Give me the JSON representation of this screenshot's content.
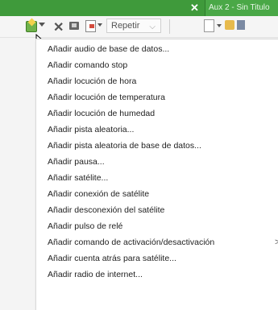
{
  "window": {
    "aux_tab_label": "Aux 2 - Sin Titulo",
    "close_glyph": "✕"
  },
  "toolbar": {
    "repeat_select_value": "Repetir",
    "icons": [
      "add-green-icon",
      "dropdown-arrow-icon",
      "delete-x-icon",
      "insert-box-icon",
      "doc-insert-icon",
      "dropdown-arrow-icon",
      "new-document-icon",
      "dropdown-arrow-icon",
      "open-folder-icon",
      "save-icon"
    ]
  },
  "menu": {
    "items": [
      {
        "label": "Añadir audio de base de datos..."
      },
      {
        "label": "Añadir comando stop"
      },
      {
        "label": "Añadir locución de hora"
      },
      {
        "label": "Añadir locución de temperatura"
      },
      {
        "label": "Añadir locución de humedad"
      },
      {
        "label": "Añadir pista aleatoria..."
      },
      {
        "label": "Añadir pista aleatoria de base de datos..."
      },
      {
        "label": "Añadir pausa..."
      },
      {
        "label": "Añadir satélite..."
      },
      {
        "label": "Añadir conexión de satélite"
      },
      {
        "label": "Añadir desconexión del satélite"
      },
      {
        "label": "Añadir pulso de relé"
      },
      {
        "label": "Añadir comando de activación/desactivación",
        "submenu": ">"
      },
      {
        "label": "Añadir cuenta atrás para satélite..."
      },
      {
        "label": "Añadir radio de internet..."
      }
    ]
  },
  "colors": {
    "titlebar": "#3f9a3b",
    "menu_bg": "#ffffff",
    "text": "#222222"
  }
}
